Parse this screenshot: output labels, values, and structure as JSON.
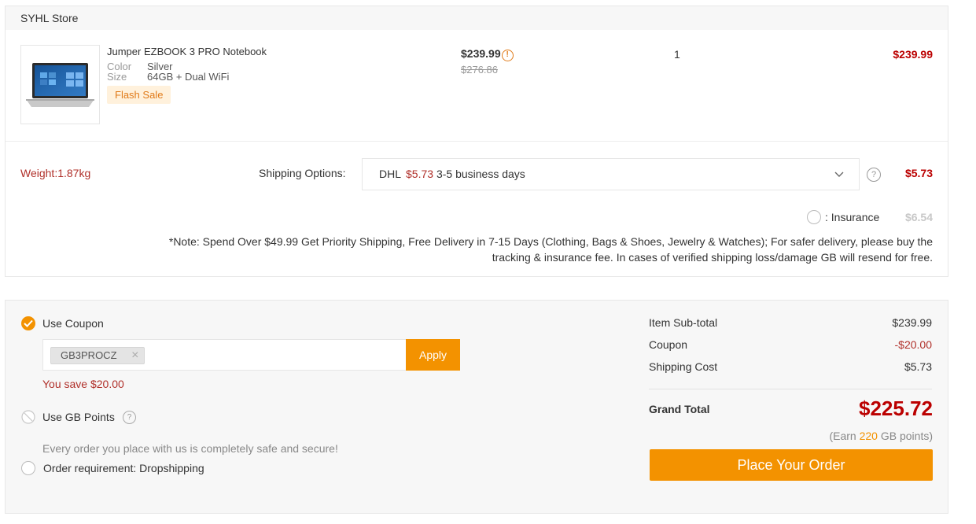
{
  "store": {
    "name": "SYHL Store"
  },
  "item": {
    "title": "Jumper EZBOOK 3 PRO Notebook",
    "attrs": [
      {
        "key": "Color",
        "value": "Silver"
      },
      {
        "key": "Size",
        "value": "64GB + Dual WiFi"
      }
    ],
    "badge": "Flash Sale",
    "price": "$239.99",
    "original_price": "$276.86",
    "quantity": "1",
    "line_total": "$239.99"
  },
  "shipping": {
    "weight": "Weight:1.87kg",
    "options_label": "Shipping Options:",
    "carrier": "DHL",
    "carrier_cost": "$5.73",
    "carrier_days": "3-5 business days",
    "cost": "$5.73",
    "insurance_label": ": Insurance",
    "insurance_price": "$6.54",
    "note": "*Note: Spend Over $49.99 Get Priority Shipping, Free Delivery in 7-15 Days (Clothing, Bags & Shoes, Jewelry & Watches); For safer delivery, please buy the tracking & insurance fee. In cases of verified shipping loss/damage GB will resend for free."
  },
  "coupon": {
    "label": "Use Coupon",
    "code": "GB3PROCZ",
    "apply_label": "Apply",
    "savings": "You save $20.00"
  },
  "points": {
    "label": "Use GB Points"
  },
  "safe_text": "Every order you place with us is completely safe and secure!",
  "dropshipping": {
    "label": "Order requirement: Dropshipping"
  },
  "summary": {
    "rows": [
      {
        "label": "Item Sub-total",
        "value": "$239.99"
      },
      {
        "label": "Coupon",
        "value": "-$20.00"
      },
      {
        "label": "Shipping Cost",
        "value": "$5.73"
      }
    ],
    "grand_total_label": "Grand Total",
    "grand_total": "$225.72",
    "earn_prefix": "(Earn",
    "earn_points": "220",
    "earn_suffix": "GB points)",
    "order_button": "Place Your Order"
  },
  "colors": {
    "accent": "#f39200",
    "price_red": "#b00000"
  }
}
